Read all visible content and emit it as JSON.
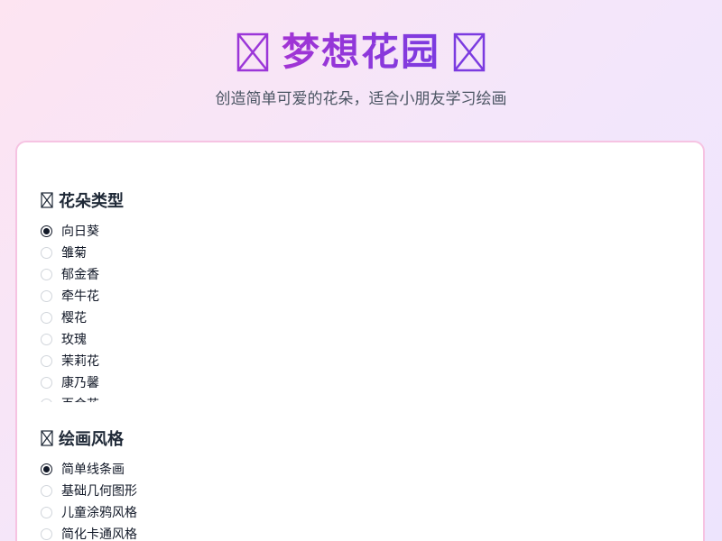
{
  "header": {
    "title": "梦想花园",
    "subtitle": "创造简单可爱的花朵，适合小朋友学习绘画",
    "icon_left": "missing-glyph-icon",
    "icon_right": "missing-glyph-icon",
    "title_gradient": [
      "#a234d4",
      "#7b3be0"
    ]
  },
  "flower_section": {
    "title": "花朵类型",
    "icon": "missing-glyph-icon",
    "selected": "向日葵",
    "options": [
      "向日葵",
      "雏菊",
      "郁金香",
      "牵牛花",
      "樱花",
      "玫瑰",
      "茉莉花",
      "康乃馨",
      "百合花"
    ]
  },
  "style_section": {
    "title": "绘画风格",
    "icon": "missing-glyph-icon",
    "selected": "简单线条画",
    "options": [
      "简单线条画",
      "基础几何图形",
      "儿童涂鸦风格",
      "简化卡通风格"
    ]
  },
  "colors": {
    "card_border": "#f6c3e2",
    "text": "#1f2937",
    "subtitle": "#4b5563"
  }
}
